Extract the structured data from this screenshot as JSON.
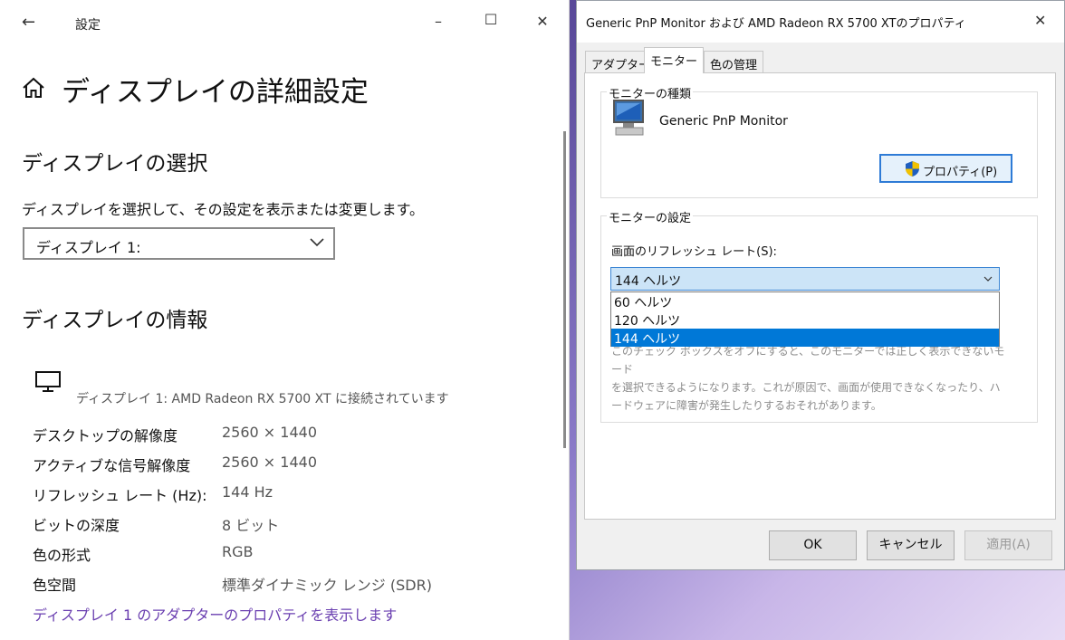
{
  "settings": {
    "window_title": "設定",
    "page_title": "ディスプレイの詳細設定",
    "section_select": "ディスプレイの選択",
    "select_description": "ディスプレイを選択して、その設定を表示または変更します。",
    "display_dropdown_value": "ディスプレイ 1:",
    "section_info": "ディスプレイの情報",
    "connected_text": "ディスプレイ 1: AMD Radeon RX 5700 XT に接続されています",
    "info": [
      {
        "label": "デスクトップの解像度",
        "value": "2560 × 1440"
      },
      {
        "label": "アクティブな信号解像度",
        "value": "2560 × 1440"
      },
      {
        "label": "リフレッシュ レート (Hz):",
        "value": "144 Hz"
      },
      {
        "label": "ビットの深度",
        "value": "8 ビット"
      },
      {
        "label": "色の形式",
        "value": "RGB"
      },
      {
        "label": "色空間",
        "value": "標準ダイナミック レンジ (SDR)"
      }
    ],
    "adapter_link": "ディスプレイ 1 のアダプターのプロパティを表示します"
  },
  "dialog": {
    "title": "Generic PnP Monitor および AMD Radeon RX 5700 XTのプロパティ",
    "tabs": [
      "アダプター",
      "モニター",
      "色の管理"
    ],
    "active_tab": "モニター",
    "monitor_type_group": "モニターの種類",
    "monitor_name": "Generic PnP Monitor",
    "properties_button": "プロパティ(P)",
    "monitor_settings_group": "モニターの設定",
    "refresh_rate_label": "画面のリフレッシュ レート(S):",
    "refresh_rate_value": "144 ヘルツ",
    "refresh_options": [
      "60 ヘルツ",
      "120 ヘルツ",
      "144 ヘルツ"
    ],
    "warning_line1": "このチェック ボックスをオフにすると、このモニターでは正しく表示できないモード",
    "warning_line2": "を選択できるようになります。これが原因で、画面が使用できなくなったり、ハ",
    "warning_line3": "ードウェアに障害が発生したりするおそれがあります。",
    "ok_button": "OK",
    "cancel_button": "キャンセル",
    "apply_button": "適用(A)"
  },
  "colors": {
    "accent": "#0078d7",
    "link": "#6a3fb0"
  }
}
